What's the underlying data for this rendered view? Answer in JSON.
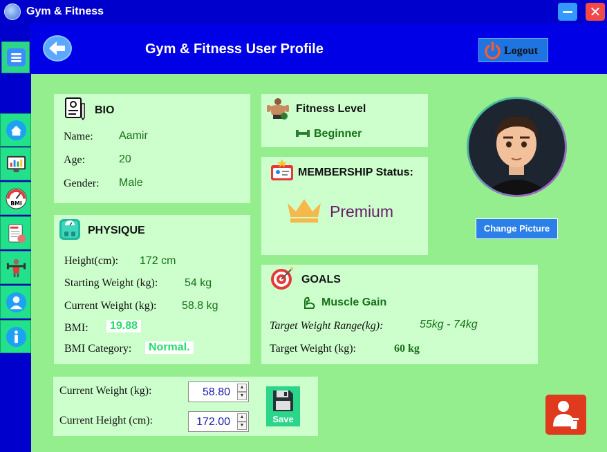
{
  "app": {
    "title": "Gym & Fitness"
  },
  "header": {
    "title": "Gym & Fitness User Profile",
    "logout_label": "Logout"
  },
  "sidebar": {
    "items": [
      {
        "name": "home-icon"
      },
      {
        "name": "dashboard-icon"
      },
      {
        "name": "bmi-icon"
      },
      {
        "name": "diet-icon"
      },
      {
        "name": "workout-icon"
      },
      {
        "name": "profile-icon"
      },
      {
        "name": "info-icon"
      }
    ]
  },
  "bio": {
    "heading": "BIO",
    "name_label": "Name:",
    "name_value": "Aamir",
    "age_label": "Age:",
    "age_value": "20",
    "gender_label": "Gender:",
    "gender_value": "Male"
  },
  "physique": {
    "heading": "PHYSIQUE",
    "height_label": "Height(cm):",
    "height_value": "172 cm",
    "start_weight_label": "Starting Weight (kg):",
    "start_weight_value": "54 kg",
    "current_weight_label": "Current Weight (kg):",
    "current_weight_value": "58.8 kg",
    "bmi_label": "BMI:",
    "bmi_value": "19.88",
    "bmi_category_label": "BMI Category:",
    "bmi_category_value": "Normal."
  },
  "fitness": {
    "heading": "Fitness Level",
    "value": "Beginner"
  },
  "membership": {
    "heading": "MEMBERSHIP Status:",
    "value": "Premium"
  },
  "goals": {
    "heading": "GOALS",
    "goal": "Muscle Gain",
    "range_label": "Target Weight Range(kg):",
    "range_value": "55kg - 74kg",
    "target_label": "Target Weight (kg):",
    "target_value": "60 kg"
  },
  "profile": {
    "change_picture_label": "Change Picture"
  },
  "update": {
    "weight_label": "Current Weight (kg):",
    "weight_value": "58.80",
    "height_label": "Current Height (cm):",
    "height_value": "172.00",
    "save_label": "Save"
  },
  "colors": {
    "accent": "#0000cd",
    "card": "#ccffcc",
    "main": "#94ee8e",
    "danger": "#e03a1e"
  }
}
